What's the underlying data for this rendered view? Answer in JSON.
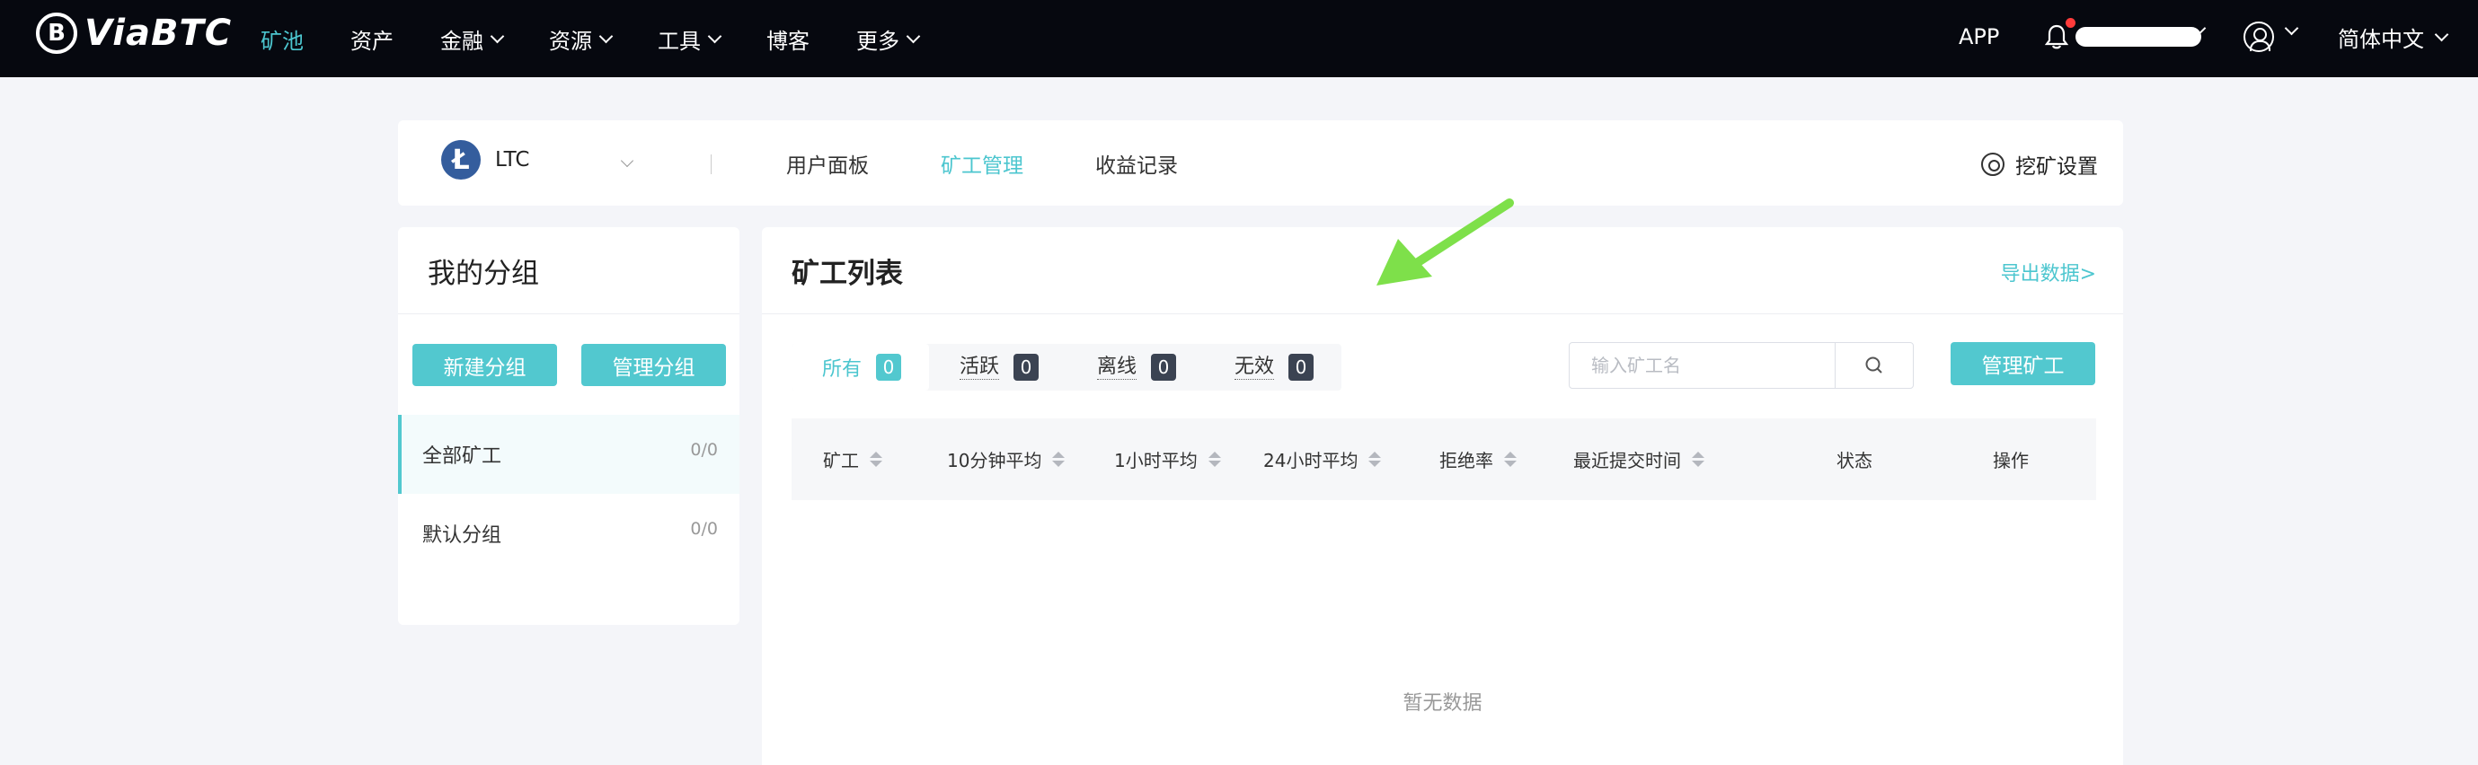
{
  "brand": {
    "logo_glyph": "B",
    "name": "ViaBTC"
  },
  "nav": {
    "items": [
      {
        "label": "矿池",
        "active": true,
        "has_dropdown": false
      },
      {
        "label": "资产",
        "active": false,
        "has_dropdown": false
      },
      {
        "label": "金融",
        "active": false,
        "has_dropdown": true
      },
      {
        "label": "资源",
        "active": false,
        "has_dropdown": true
      },
      {
        "label": "工具",
        "active": false,
        "has_dropdown": true
      },
      {
        "label": "博客",
        "active": false,
        "has_dropdown": false
      },
      {
        "label": "更多",
        "active": false,
        "has_dropdown": true
      }
    ],
    "app_label": "APP",
    "language": "简体中文"
  },
  "coin_bar": {
    "coin_symbol": "LTC",
    "coin_glyph": "Ł",
    "tabs": [
      {
        "label": "用户面板",
        "active": false
      },
      {
        "label": "矿工管理",
        "active": true
      },
      {
        "label": "收益记录",
        "active": false
      }
    ],
    "settings_label": "挖矿设置"
  },
  "groups": {
    "title": "我的分组",
    "new_button": "新建分组",
    "manage_button": "管理分组",
    "items": [
      {
        "label": "全部矿工",
        "count": "0/0",
        "active": true
      },
      {
        "label": "默认分组",
        "count": "0/0",
        "active": false
      }
    ]
  },
  "miners": {
    "title": "矿工列表",
    "export_link": "导出数据>",
    "tabs": [
      {
        "label": "所有",
        "count": "0",
        "active": true
      },
      {
        "label": "活跃",
        "count": "0",
        "active": false
      },
      {
        "label": "离线",
        "count": "0",
        "active": false
      },
      {
        "label": "无效",
        "count": "0",
        "active": false
      }
    ],
    "search_placeholder": "输入矿工名",
    "manage_button": "管理矿工",
    "columns": [
      {
        "label": "矿工",
        "sortable": true
      },
      {
        "label": "10分钟平均",
        "sortable": true
      },
      {
        "label": "1小时平均",
        "sortable": true
      },
      {
        "label": "24小时平均",
        "sortable": true
      },
      {
        "label": "拒绝率",
        "sortable": true
      },
      {
        "label": "最近提交时间",
        "sortable": true
      },
      {
        "label": "状态",
        "sortable": false
      },
      {
        "label": "操作",
        "sortable": false
      }
    ],
    "empty_text": "暂无数据"
  },
  "colors": {
    "accent": "#4cc6cf",
    "button": "#52c8cf",
    "nav_bg": "#06080f",
    "annotation_arrow": "#7ee04a",
    "notification_dot": "#ff3b3b"
  },
  "icons": [
    "bell-icon",
    "user-icon",
    "gear-icon",
    "search-icon",
    "litecoin-icon",
    "chevron-down-icon",
    "sort-icon",
    "annotation-arrow"
  ]
}
